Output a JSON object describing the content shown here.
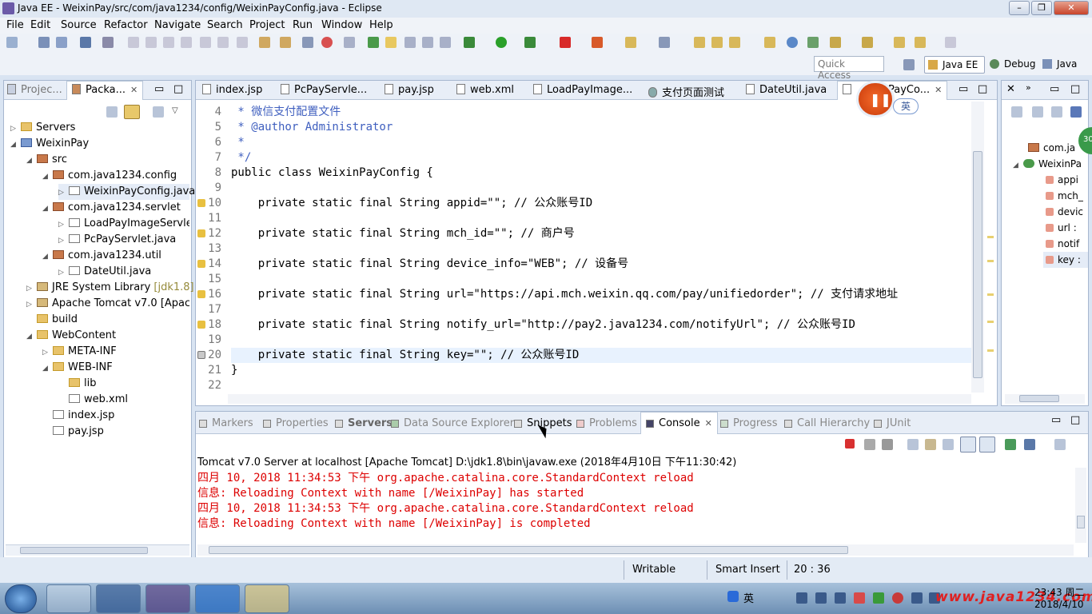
{
  "window": {
    "title": "Java EE - WeixinPay/src/com/java1234/config/WeixinPayConfig.java - Eclipse"
  },
  "menu": [
    "File",
    "Edit",
    "Source",
    "Refactor",
    "Navigate",
    "Search",
    "Project",
    "Run",
    "Window",
    "Help"
  ],
  "toolbar": {
    "quick_access": "Quick Access",
    "perspectives": [
      "Java EE",
      "Debug",
      "Java"
    ]
  },
  "explorer": {
    "tabs": [
      "Projec...",
      "Packa..."
    ],
    "tree": [
      {
        "label": "Servers",
        "icon": "folder"
      },
      {
        "label": "WeixinPay",
        "icon": "project"
      },
      {
        "label": "src",
        "icon": "src-folder"
      },
      {
        "label": "com.java1234.config",
        "icon": "package"
      },
      {
        "label": "WeixinPayConfig.java",
        "icon": "java-file"
      },
      {
        "label": "com.java1234.servlet",
        "icon": "package"
      },
      {
        "label": "LoadPayImageServlet.j",
        "icon": "java-file"
      },
      {
        "label": "PcPayServlet.java",
        "icon": "java-file"
      },
      {
        "label": "com.java1234.util",
        "icon": "package"
      },
      {
        "label": "DateUtil.java",
        "icon": "java-file"
      },
      {
        "label": "JRE System Library",
        "decoration": "[jdk1.8]",
        "icon": "library"
      },
      {
        "label": "Apache Tomcat v7.0 [Apache",
        "icon": "library"
      },
      {
        "label": "build",
        "icon": "folder"
      },
      {
        "label": "WebContent",
        "icon": "folder"
      },
      {
        "label": "META-INF",
        "icon": "folder"
      },
      {
        "label": "WEB-INF",
        "icon": "folder"
      },
      {
        "label": "lib",
        "icon": "folder"
      },
      {
        "label": "web.xml",
        "icon": "xml-file"
      },
      {
        "label": "index.jsp",
        "icon": "jsp-file"
      },
      {
        "label": "pay.jsp",
        "icon": "jsp-file"
      }
    ]
  },
  "editor": {
    "tabs": [
      "index.jsp",
      "PcPayServle...",
      "pay.jsp",
      "web.xml",
      "LoadPayImage...",
      "支付页面测试",
      "DateUtil.java",
      "PayCo..."
    ],
    "recording_badge": "英",
    "lines": [
      {
        "n": "4",
        "t": " * 微信支付配置文件"
      },
      {
        "n": "5",
        "t": " * @author Administrator"
      },
      {
        "n": "6",
        "t": " *"
      },
      {
        "n": "7",
        "t": " */"
      },
      {
        "n": "8",
        "t": "public class WeixinPayConfig {"
      },
      {
        "n": "9",
        "t": ""
      },
      {
        "n": "10",
        "t": "    private static final String appid=\"\"; // 公众账号ID"
      },
      {
        "n": "11",
        "t": ""
      },
      {
        "n": "12",
        "t": "    private static final String mch_id=\"\"; // 商户号"
      },
      {
        "n": "13",
        "t": ""
      },
      {
        "n": "14",
        "t": "    private static final String device_info=\"WEB\"; // 设备号"
      },
      {
        "n": "15",
        "t": ""
      },
      {
        "n": "16",
        "t": "    private static final String url=\"https://api.mch.weixin.qq.com/pay/unifiedorder\"; // 支付请求地址"
      },
      {
        "n": "17",
        "t": ""
      },
      {
        "n": "18",
        "t": "    private static final String notify_url=\"http://pay2.java1234.com/notifyUrl\"; // 公众账号ID"
      },
      {
        "n": "19",
        "t": ""
      },
      {
        "n": "20",
        "t": "    private static final String key=\"\"; // 公众账号ID"
      },
      {
        "n": "21",
        "t": "}"
      },
      {
        "n": "22",
        "t": ""
      }
    ]
  },
  "outline": {
    "items": [
      "com.ja",
      "WeixinPa",
      "appi",
      "mch_",
      "devic",
      "url :",
      "notif",
      "key :"
    ],
    "badge": "30"
  },
  "bottom": {
    "tabs": [
      "Markers",
      "Properties",
      "Servers",
      "Data Source Explorer",
      "Snippets",
      "Problems",
      "Console",
      "Progress",
      "Call Hierarchy",
      "JUnit"
    ],
    "console_header": "Tomcat v7.0 Server at localhost [Apache Tomcat] D:\\jdk1.8\\bin\\javaw.exe (2018年4月10日 下午11:30:42)",
    "console_lines": [
      "四月 10, 2018 11:34:53 下午 org.apache.catalina.core.StandardContext reload",
      "信息: Reloading Context with name [/WeixinPay] has started",
      "四月 10, 2018 11:34:53 下午 org.apache.catalina.core.StandardContext reload",
      "信息: Reloading Context with name [/WeixinPay] is completed"
    ]
  },
  "status": {
    "writable": "Writable",
    "insert": "Smart Insert",
    "position": "20 : 36"
  },
  "taskbar": {
    "ime": "英",
    "time": "23:43 周二",
    "date": "2018/4/10",
    "watermark": "www.java1234.com"
  }
}
